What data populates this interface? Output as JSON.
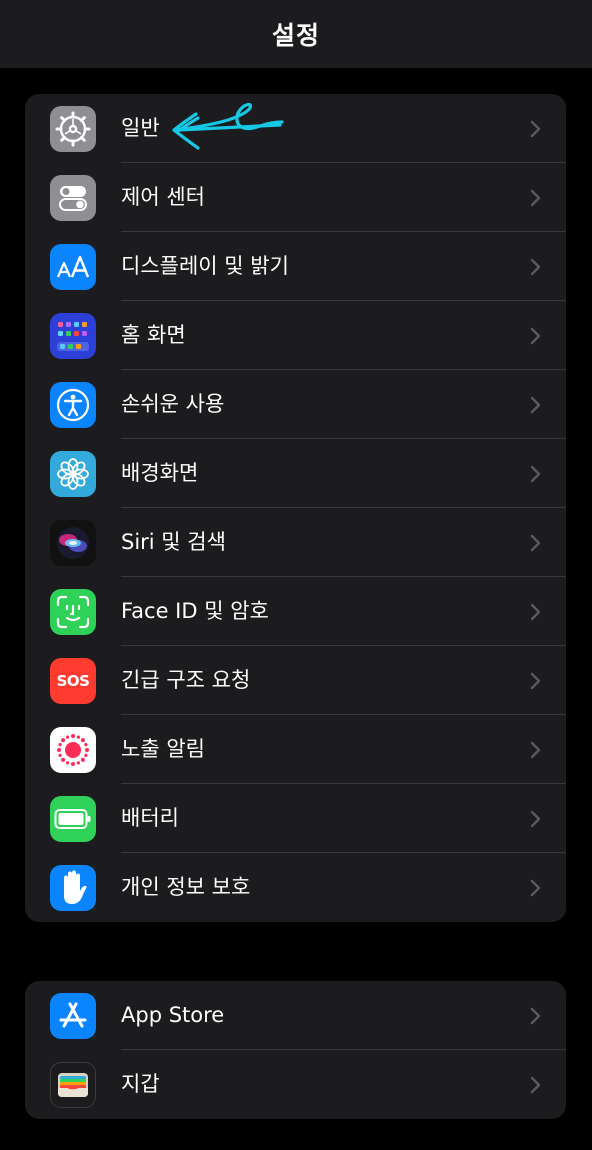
{
  "nav": {
    "title": "설정"
  },
  "group1": {
    "items": [
      {
        "label": "일반",
        "icon": "gear-icon",
        "color": "#8e8e93"
      },
      {
        "label": "제어 센터",
        "icon": "toggles-icon",
        "color": "#8e8e93"
      },
      {
        "label": "디스플레이 및 밝기",
        "icon": "text-size-icon",
        "color": "#0a84ff"
      },
      {
        "label": "홈 화면",
        "icon": "home-grid-icon",
        "color": "#2c3fd6"
      },
      {
        "label": "손쉬운 사용",
        "icon": "accessibility-icon",
        "color": "#0a84ff"
      },
      {
        "label": "배경화면",
        "icon": "flower-icon",
        "color": "#34aadc"
      },
      {
        "label": "Siri 및 검색",
        "icon": "siri-icon",
        "color": "#111111"
      },
      {
        "label": "Face ID 및 암호",
        "icon": "face-id-icon",
        "color": "#30d158"
      },
      {
        "label": "긴급 구조 요청",
        "icon": "sos-icon",
        "color": "#ff3b30",
        "icon_text": "SOS"
      },
      {
        "label": "노출 알림",
        "icon": "exposure-icon",
        "color": "#ffffff"
      },
      {
        "label": "배터리",
        "icon": "battery-icon",
        "color": "#30d158"
      },
      {
        "label": "개인 정보 보호",
        "icon": "hand-icon",
        "color": "#0a84ff"
      }
    ]
  },
  "group2": {
    "items": [
      {
        "label": "App Store",
        "icon": "app-store-icon",
        "color": "#0a84ff"
      },
      {
        "label": "지갑",
        "icon": "wallet-icon",
        "color": "#1c1c1e"
      }
    ]
  },
  "annotation": {
    "icon": "hand-drawn-arrow-icon",
    "color": "#14c8e6"
  }
}
